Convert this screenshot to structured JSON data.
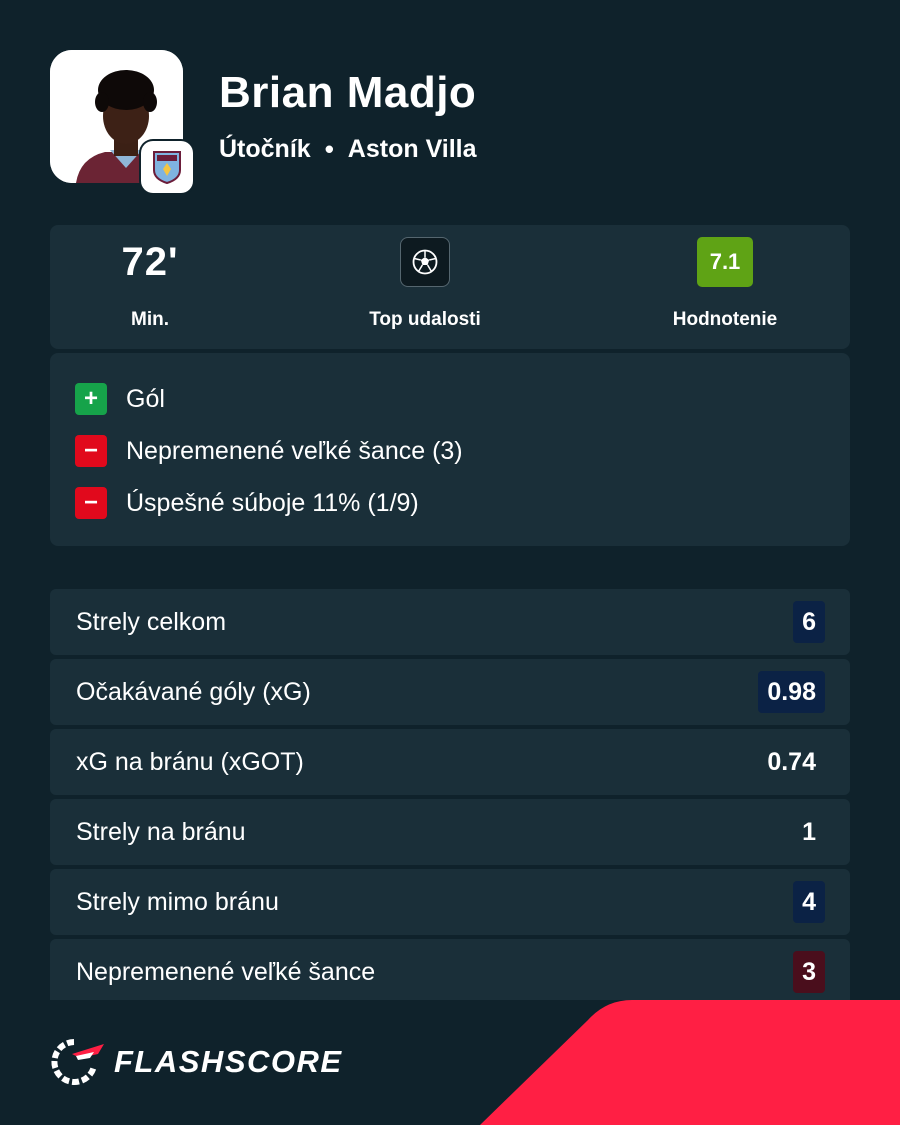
{
  "player": {
    "name": "Brian Madjo",
    "position": "Útočník",
    "separator": "•",
    "team": "Aston Villa"
  },
  "summary": {
    "minutes_value": "72'",
    "minutes_label": "Min.",
    "top_events_label": "Top udalosti",
    "rating_value": "7.1",
    "rating_label": "Hodnotenie"
  },
  "events": [
    {
      "type": "positive",
      "icon": "+",
      "label": "Gól"
    },
    {
      "type": "negative",
      "icon": "−",
      "label": "Nepremenené veľké šance (3)"
    },
    {
      "type": "negative",
      "icon": "−",
      "label": "Úspešné súboje 11% (1/9)"
    }
  ],
  "stats": [
    {
      "label": "Strely celkom",
      "value": "6",
      "highlight": "blue"
    },
    {
      "label": "Očakávané góly (xG)",
      "value": "0.98",
      "highlight": "blue"
    },
    {
      "label": "xG na bránu (xGOT)",
      "value": "0.74",
      "highlight": "none"
    },
    {
      "label": "Strely na bránu",
      "value": "1",
      "highlight": "none"
    },
    {
      "label": "Strely mimo bránu",
      "value": "4",
      "highlight": "blue"
    },
    {
      "label": "Nepremenené veľké šance",
      "value": "3",
      "highlight": "red"
    }
  ],
  "brand": {
    "name": "FLASHSCORE"
  },
  "colors": {
    "background": "#0f222b",
    "card": "#1a2f39",
    "rating_green": "#5fa315",
    "positive_green": "#16a34a",
    "negative_red": "#e1091c",
    "accent_red": "#ff1f44",
    "value_blue": "#0b2245",
    "value_red": "#4a0e1c"
  },
  "icons": {
    "top_events": "soccer-ball-icon",
    "club": "aston-villa-crest-icon",
    "brand": "flashscore-logo-icon"
  }
}
